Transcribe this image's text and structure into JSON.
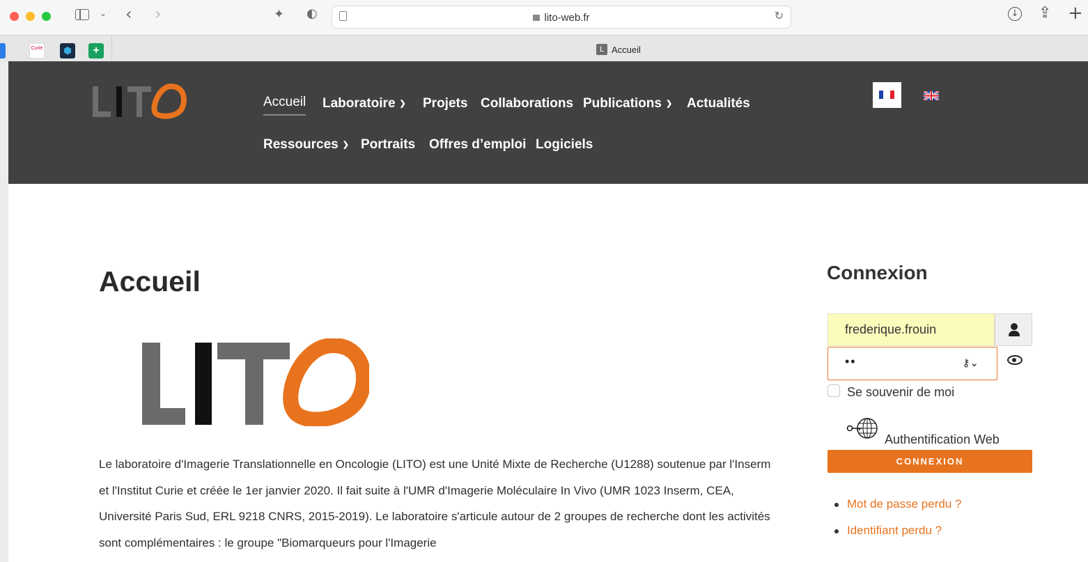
{
  "browser": {
    "url": "lito-web.fr",
    "tab_title": "Accueil",
    "tab_favicon_letter": "L",
    "favicon_bar_text": "Curie"
  },
  "site": {
    "logo_text": "LITO",
    "nav": {
      "row1": [
        "Accueil",
        "Laboratoire",
        "Projets",
        "Collaborations",
        "Publications",
        "Actualités"
      ],
      "row2": [
        "Ressources",
        "Portraits",
        "Offres d’emploi",
        "Logiciels"
      ]
    }
  },
  "main": {
    "title": "Accueil",
    "body": "Le laboratoire d'Imagerie Translationnelle en Oncologie (LITO) est une Unité Mixte de Recherche (U1288) soutenue par l'Inserm et l'Institut Curie et créée le 1er janvier 2020. Il fait suite à l'UMR d'Imagerie Moléculaire In Vivo (UMR 1023 Inserm, CEA, Université Paris Sud, ERL 9218 CNRS, 2015-2019). Le laboratoire s'articule autour de 2 groupes de recherche dont les activités sont complémentaires : le groupe \"Biomarqueurs pour l'Imagerie"
  },
  "login": {
    "title": "Connexion",
    "username": "frederique.frouin",
    "password_mask": "••",
    "remember_label": "Se souvenir de moi",
    "webauth_label": "Authentification Web",
    "submit_label": "CONNEXION",
    "links": [
      "Mot de passe perdu ?",
      "Identifiant perdu ?"
    ]
  },
  "colors": {
    "accent": "#e8731e",
    "header_bg": "#414141"
  }
}
